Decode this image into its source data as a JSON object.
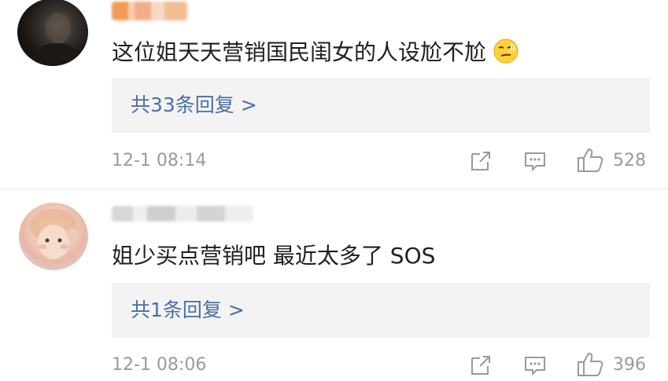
{
  "comments": [
    {
      "text": "这位姐天天营销国民闺女的人设尬不尬",
      "emoji": "smirk-emoji",
      "replies_label": "共33条回复 >",
      "timestamp": "12-1 08:14",
      "likes": "528"
    },
    {
      "text": "姐少买点营销吧 最近太多了 SOS",
      "replies_label": "共1条回复 >",
      "timestamp": "12-1 08:06",
      "likes": "396"
    }
  ],
  "colors": {
    "reply_link": "#4a6fa5",
    "meta_text": "#9a9a9a",
    "reply_box_bg": "#f3f3f3"
  },
  "icons": [
    "share-icon",
    "comment-icon",
    "thumbs-up-icon"
  ]
}
